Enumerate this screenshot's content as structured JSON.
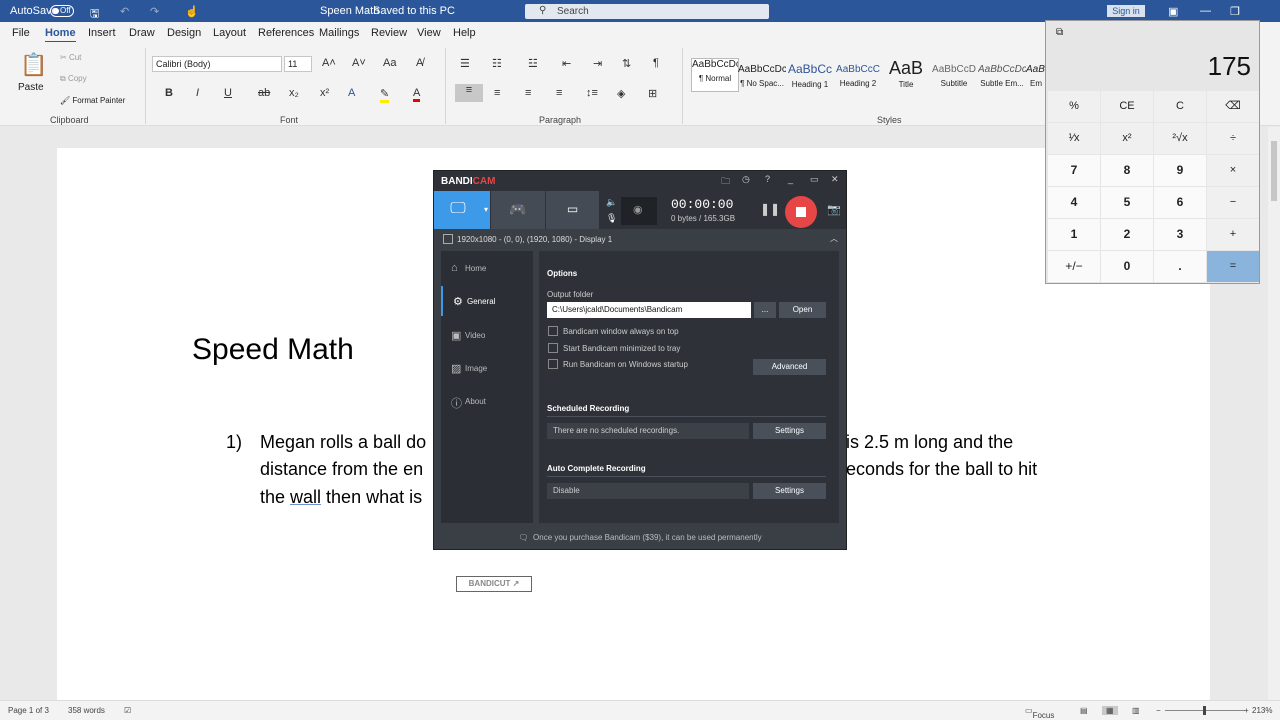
{
  "titlebar": {
    "autosave": "AutoSave",
    "toggle": "Off",
    "doc_title": "Speen Math",
    "saved_status": "Saved to this PC",
    "search_placeholder": "Search",
    "signin": "Sign in"
  },
  "menu_tabs": [
    "File",
    "Home",
    "Insert",
    "Draw",
    "Design",
    "Layout",
    "References",
    "Mailings",
    "Review",
    "View",
    "Help"
  ],
  "ribbon": {
    "clipboard": {
      "paste": "Paste",
      "cut": "Cut",
      "copy": "Copy",
      "format_painter": "Format Painter",
      "label": "Clipboard"
    },
    "font": {
      "name": "Calibri (Body)",
      "size": "11",
      "label": "Font"
    },
    "paragraph": {
      "label": "Paragraph"
    },
    "styles": {
      "label": "Styles",
      "items": [
        {
          "sample": "AaBbCcDc",
          "name": "¶ Normal"
        },
        {
          "sample": "AaBbCcDc",
          "name": "¶ No Spac..."
        },
        {
          "sample": "AaBbCc",
          "name": "Heading 1"
        },
        {
          "sample": "AaBbCcC",
          "name": "Heading 2"
        },
        {
          "sample": "AaB",
          "name": "Title"
        },
        {
          "sample": "AaBbCcD",
          "name": "Subtitle"
        },
        {
          "sample": "AaBbCcDc",
          "name": "Subtle Em..."
        },
        {
          "sample": "AaBbCcDc",
          "name": "Em"
        }
      ]
    }
  },
  "document": {
    "title": "Speed Math",
    "item_number": "1)",
    "line1_left": "Megan rolls a ball do",
    "line1_right": "is 2.5 m long and the",
    "line2_left": "distance from the en",
    "line2_right": "econds for the ball to hit",
    "line3_left_a": "the ",
    "line3_underlined": "wall",
    "line3_left_b": " then what is"
  },
  "statusbar": {
    "page": "Page 1 of 3",
    "words": "358 words",
    "focus": "Focus",
    "zoom": "213%"
  },
  "bandicam": {
    "logo_a": "BANDI",
    "logo_b": "CAM",
    "timer": "00:00:00",
    "bytes": "0 bytes / 165.3GB",
    "display": "1920x1080 - (0, 0), (1920, 1080) - Display 1",
    "sidebar": [
      "Home",
      "General",
      "Video",
      "Image",
      "About"
    ],
    "options_title": "Options",
    "output_folder_label": "Output folder",
    "output_folder_value": "C:\\Users\\jcald\\Documents\\Bandicam",
    "browse": "...",
    "open": "Open",
    "checkboxes": [
      "Bandicam window always on top",
      "Start Bandicam minimized to tray",
      "Run Bandicam on Windows startup"
    ],
    "advanced": "Advanced",
    "scheduled_title": "Scheduled Recording",
    "scheduled_value": "There are no scheduled recordings.",
    "settings": "Settings",
    "autocomplete_title": "Auto Complete Recording",
    "autocomplete_value": "Disable",
    "bandicut": "BANDICUT",
    "footer": "Once you purchase Bandicam ($39), it can be used permanently"
  },
  "calculator": {
    "display": "175",
    "keys": [
      [
        "%",
        "CE",
        "C",
        "⌫"
      ],
      [
        "¹⁄x",
        "x²",
        "²√x",
        "÷"
      ],
      [
        "7",
        "8",
        "9",
        "×"
      ],
      [
        "4",
        "5",
        "6",
        "−"
      ],
      [
        "1",
        "2",
        "3",
        "+"
      ],
      [
        "+/−",
        "0",
        ".",
        "="
      ]
    ]
  }
}
